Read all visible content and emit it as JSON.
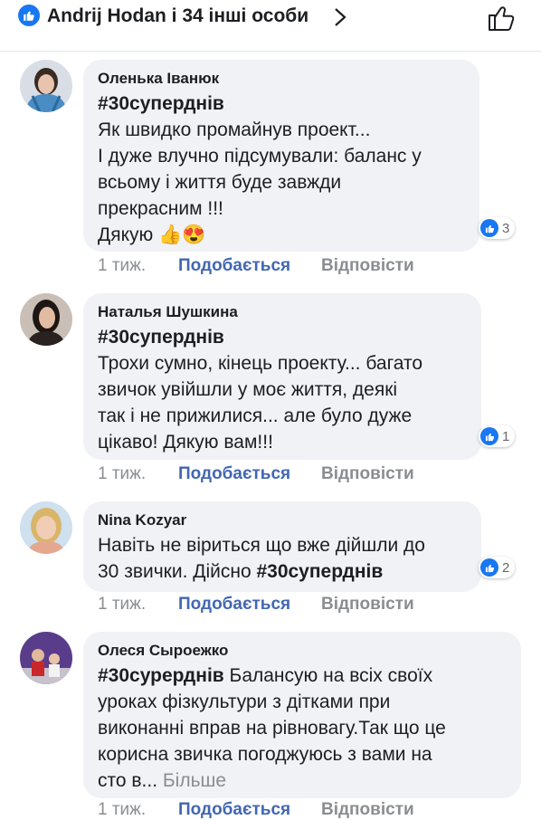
{
  "header": {
    "reactors_text": "Andrij Hodan і 34 інші особи",
    "reaction_icon": "like-icon",
    "accent": "#1877f2"
  },
  "comments": [
    {
      "author": "Оленька Іванюк",
      "lines": [
        {
          "hashtag": "#30суперднів",
          "text": ""
        },
        {
          "text": "Як швидко промайнув проект..."
        },
        {
          "text": "І дуже влучно підсумували: баланс у"
        },
        {
          "text": "всьому і життя буде завжди"
        },
        {
          "text": "прекрасним !!!"
        },
        {
          "text": "Дякую 👍😍"
        }
      ],
      "reactions": "3",
      "time": "1 тиж.",
      "like_label": "Подобається",
      "reply_label": "Відповісти"
    },
    {
      "author": "Наталья Шушкина",
      "lines": [
        {
          "hashtag": "#30суперднів",
          "text": ""
        },
        {
          "text": "Трохи сумно, кінець проекту... багато"
        },
        {
          "text": "звичок увійшли у моє життя, деякі"
        },
        {
          "text": "так і не прижилися... але було дуже"
        },
        {
          "text": "цікаво! Дякую вам!!!"
        }
      ],
      "reactions": "1",
      "time": "1 тиж.",
      "like_label": "Подобається",
      "reply_label": "Відповісти"
    },
    {
      "author": "Nina  Kozyar",
      "lines": [
        {
          "text": "Навіть не віриться що вже дійшли до"
        },
        {
          "text": "30 звички. Дійсно ",
          "hashtag_after": "#30суперднів"
        }
      ],
      "reactions": "2",
      "time": "1 тиж.",
      "like_label": "Подобається",
      "reply_label": "Відповісти"
    },
    {
      "author": "Олеся Сыроежко",
      "lines": [
        {
          "hashtag": "#30сурерднів",
          "text": "  Балансую на всіх своїх"
        },
        {
          "text": "уроках фізкультури з дітками при"
        },
        {
          "text": "виконанні вправ на рівновагу.Так що це"
        },
        {
          "text": "корисна звичка погоджуюсь з вами на"
        },
        {
          "text": "сто в... ",
          "more": "Більше"
        }
      ],
      "time": "1 тиж.",
      "like_label": "Подобається",
      "reply_label": "Відповісти"
    }
  ]
}
